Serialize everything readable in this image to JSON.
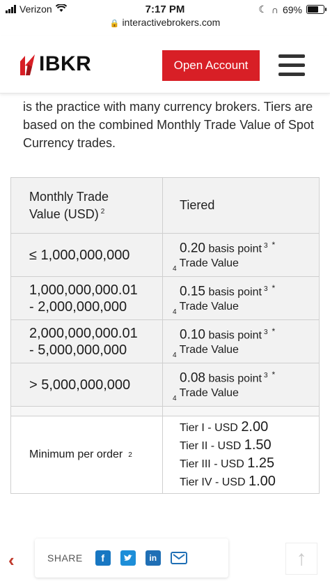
{
  "status": {
    "carrier": "Verizon",
    "time": "7:17 PM",
    "battery": "69%"
  },
  "browser": {
    "url": "interactivebrokers.com"
  },
  "header": {
    "logo": "IBKR",
    "open_account": "Open Account"
  },
  "intro_text": "is the practice with many currency brokers. Tiers are based on the combined Monthly Trade Value of Spot Currency trades.",
  "table": {
    "col1_header_line1": "Monthly Trade",
    "col1_header_line2": "Value (USD)",
    "col1_header_note": "2",
    "col2_header": "Tiered",
    "rows": [
      {
        "value_line1": "≤ 1,000,000,000",
        "value_line2": "",
        "rate": "0.20",
        "unit": "basis point",
        "note": "3",
        "note2": "4",
        "star": "*",
        "suffix": "Trade Value"
      },
      {
        "value_line1": "1,000,000,000.01",
        "value_line2": "- 2,000,000,000",
        "rate": "0.15",
        "unit": "basis point",
        "note": "3",
        "note2": "4",
        "star": "*",
        "suffix": "Trade Value"
      },
      {
        "value_line1": "2,000,000,000.01",
        "value_line2": "- 5,000,000,000",
        "rate": "0.10",
        "unit": "basis point",
        "note": "3",
        "note2": "4",
        "star": "*",
        "suffix": "Trade Value"
      },
      {
        "value_line1": "> 5,000,000,000",
        "value_line2": "",
        "rate": "0.08",
        "unit": "basis point",
        "note": "3",
        "note2": "4",
        "star": "*",
        "suffix": "Trade Value"
      }
    ],
    "minimum": {
      "label": "Minimum per order",
      "note": "2",
      "tiers": [
        {
          "prefix": "Tier I - USD",
          "amount": "2.00"
        },
        {
          "prefix": "Tier II - USD",
          "amount": "1.50"
        },
        {
          "prefix": "Tier III - USD",
          "amount": "1.25"
        },
        {
          "prefix": "Tier IV - USD",
          "amount": "1.00"
        }
      ]
    }
  },
  "share_bar": {
    "label": "SHARE",
    "icons": [
      "facebook-icon",
      "twitter-icon",
      "linkedin-icon",
      "email-icon"
    ]
  },
  "colors": {
    "brand_red": "#d81f26",
    "accent_blue": "#1877c2"
  }
}
